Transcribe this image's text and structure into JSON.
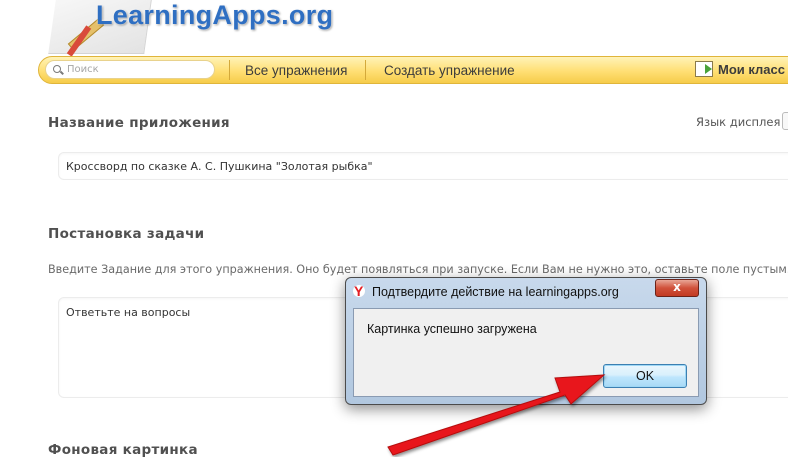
{
  "brand": {
    "logo_text": "LearningApps.org"
  },
  "nav": {
    "search_placeholder": "Поиск",
    "all_exercises": "Все упражнения",
    "create_exercise": "Создать упражнение",
    "my_classes": "Мои класс"
  },
  "form": {
    "app_name_heading": "Название приложения",
    "display_language_label": "Язык дисплея",
    "app_name_value": "Кроссворд по сказке А. С. Пушкина \"Золотая рыбка\"",
    "task_heading": "Постановка задачи",
    "task_hint": "Введите Задание для этого упражнения. Оно будет появляться при запуске. Если Вам не нужно это, оставьте поле пустым.",
    "task_value": "Ответьте на вопросы",
    "background_heading": "Фоновая картинка"
  },
  "dialog": {
    "title": "Подтвердите действие на learningapps.org",
    "close_label": "x",
    "message": "Картинка успешно загружена",
    "ok_label": "OK"
  },
  "colors": {
    "brand_blue": "#2f6fc2",
    "nav_yellow": "#ffdf74",
    "arrow_red": "#e8181a"
  }
}
